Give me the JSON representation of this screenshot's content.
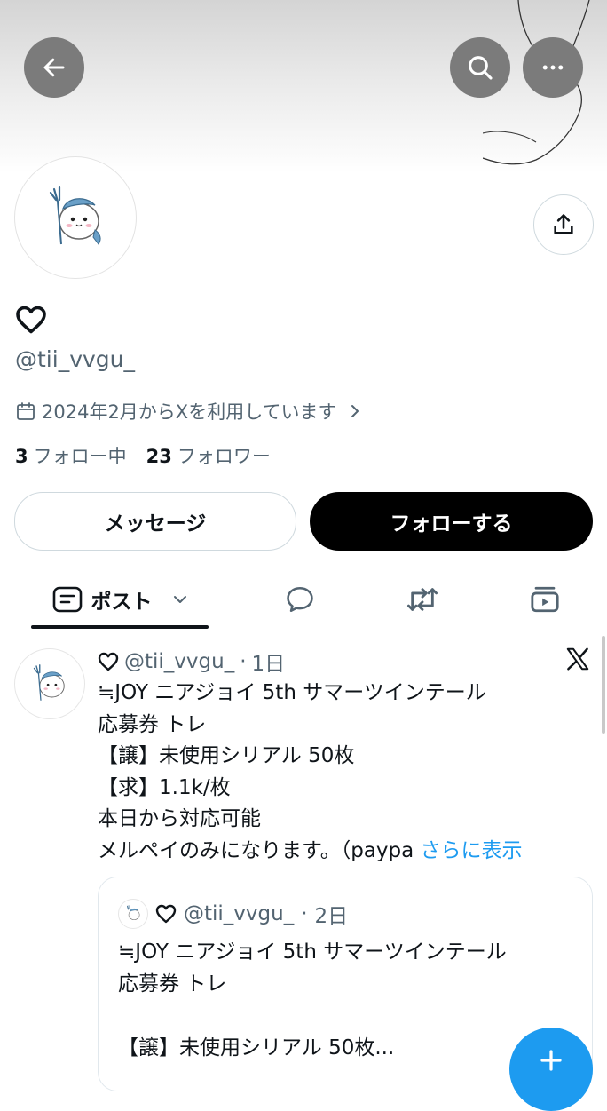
{
  "header": {
    "back_icon": "arrow-left-icon",
    "search_icon": "search-icon",
    "more_icon": "more-horizontal-icon"
  },
  "profile": {
    "display_name_icon": "heart-outline-icon",
    "handle": "@tii_vvgu_",
    "joined": "2024年2月からXを利用しています",
    "following_count": "3",
    "following_label": "フォロー中",
    "followers_count": "23",
    "followers_label": "フォロワー",
    "share_icon": "share-icon"
  },
  "actions": {
    "message_label": "メッセージ",
    "follow_label": "フォローする"
  },
  "tabs": {
    "posts_label": "ポスト",
    "items": [
      "posts-icon",
      "replies-icon",
      "reposts-icon",
      "media-icon"
    ]
  },
  "post": {
    "handle": "@tii_vvgu_",
    "time": "1日",
    "lines": [
      "≒JOY ニアジョイ 5th サマーツインテール",
      "応募券 トレ",
      "【譲】未使用シリアル 50枚",
      "【求】1.1k/枚",
      "本日から対応可能",
      "メルペイのみになります。（paypa"
    ],
    "show_more": "さらに表示",
    "quote": {
      "handle": "@tii_vvgu_",
      "time": "2日",
      "lines": [
        "≒JOY ニアジョイ 5th サマーツインテール",
        "応募券 トレ",
        "",
        "【譲】未使用シリアル 50枚..."
      ]
    }
  },
  "colors": {
    "accent": "#1d9bf0",
    "text_primary": "#0f1419",
    "text_secondary": "#536471",
    "overlay_button": "#7b7b7b"
  }
}
